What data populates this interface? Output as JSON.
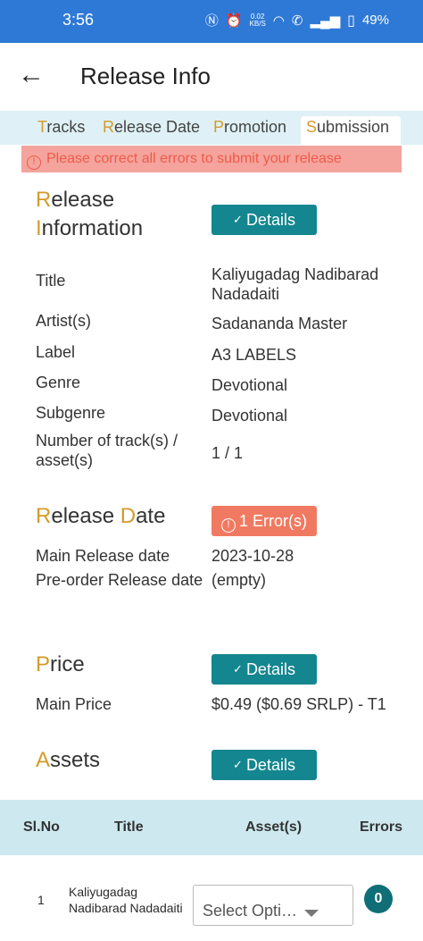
{
  "status_bar": {
    "time": "3:56",
    "net_speed": "0.02",
    "net_unit": "KB/S",
    "battery": "49%"
  },
  "app_bar": {
    "title": "Release Info"
  },
  "tabs": [
    {
      "first": "T",
      "rest": "racks"
    },
    {
      "first": "R",
      "rest": "elease Date"
    },
    {
      "first": "P",
      "rest": "romotion"
    },
    {
      "first": "S",
      "rest": "ubmission",
      "active": true
    }
  ],
  "error_banner": "Please correct all errors to submit your release",
  "release_information": {
    "heading_line1_cap": "R",
    "heading_line1_rest": "elease",
    "heading_line2_cap": "I",
    "heading_line2_rest": "nformation",
    "details_label": "Details",
    "rows": [
      {
        "label": "Title",
        "value": "Kaliyugadag Nadibarad Nadadaiti"
      },
      {
        "label": "Artist(s)",
        "value": "Sadananda Master"
      },
      {
        "label": "Label",
        "value": "A3 LABELS"
      },
      {
        "label": "Genre",
        "value": "Devotional"
      },
      {
        "label": "Subgenre",
        "value": "Devotional"
      },
      {
        "label": "Number of track(s) / asset(s)",
        "value": "1 / 1"
      }
    ]
  },
  "release_date": {
    "heading_cap1": "R",
    "heading_rest1": "elease ",
    "heading_cap2": "D",
    "heading_rest2": "ate",
    "error_label": "1 Error(s)",
    "rows": [
      {
        "label": "Main Release date",
        "value": "2023-10-28"
      },
      {
        "label": "Pre-order Release date",
        "value": "(empty)"
      }
    ]
  },
  "price": {
    "heading_cap": "P",
    "heading_rest": "rice",
    "details_label": "Details",
    "rows": [
      {
        "label": "Main Price",
        "value": "$0.49 ($0.69 SRLP) - T1"
      }
    ]
  },
  "assets": {
    "heading_cap": "A",
    "heading_rest": "ssets",
    "details_label": "Details",
    "table": {
      "headers": [
        "Sl.No",
        "Title",
        "Asset(s)",
        "Errors"
      ],
      "rows": [
        {
          "sl": "1",
          "title": "Kaliyugadag Nadibarad Nadadaiti",
          "select": "Select Opti…",
          "errors": "0"
        }
      ]
    }
  },
  "colors": {
    "accent": "#14868f",
    "status_bar": "#2f79d6",
    "heading_cap": "#d49b2b",
    "error": "#f07a61"
  }
}
